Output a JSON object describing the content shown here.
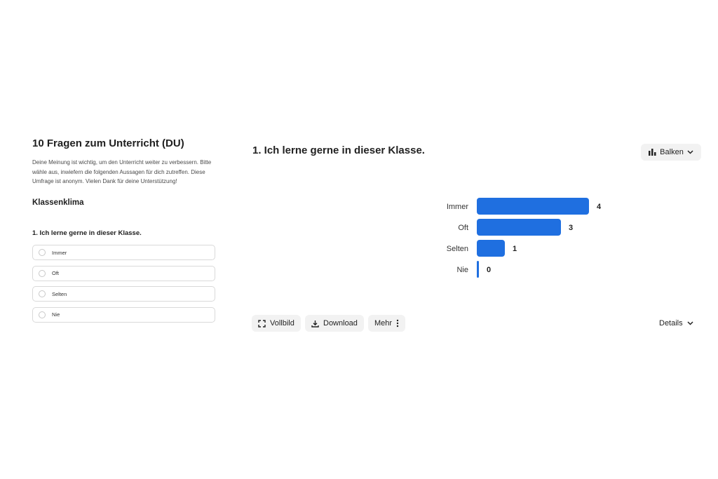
{
  "survey": {
    "title": "10 Fragen zum Unterricht (DU)",
    "description": "Deine Meinung ist wichtig, um den Unterricht weiter zu verbessern. Bitte wähle aus, inwiefern die folgenden Aussagen für dich zutreffen. Diese Umfrage ist anonym. Vielen Dank für deine Unterstützung!",
    "section": "Klassenklima",
    "question": "1. Ich lerne gerne in dieser Klasse.",
    "options": [
      "Immer",
      "Oft",
      "Selten",
      "Nie"
    ]
  },
  "results": {
    "title": "1. Ich lerne gerne in dieser Klasse.",
    "chart_type_label": "Balken",
    "toolbar": {
      "fullscreen": "Vollbild",
      "download": "Download",
      "more": "Mehr",
      "details": "Details"
    }
  },
  "colors": {
    "bar": "#1f6fe0",
    "button_bg": "#f2f2f2"
  },
  "chart_data": {
    "type": "bar",
    "orientation": "horizontal",
    "categories": [
      "Immer",
      "Oft",
      "Selten",
      "Nie"
    ],
    "values": [
      4,
      3,
      1,
      0
    ],
    "xlim": [
      0,
      4
    ],
    "grid": false
  }
}
